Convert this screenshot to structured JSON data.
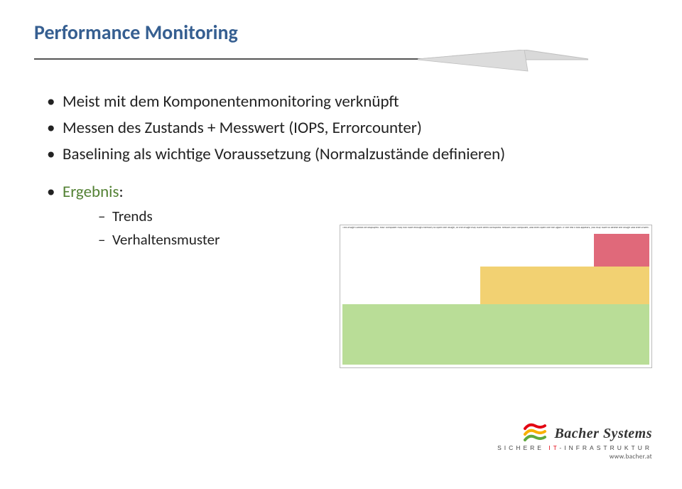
{
  "title": "Performance Monitoring",
  "bullets": [
    "Meist mit dem Komponentenmonitoring verknüpft",
    "Messen des Zustands + Messwert (IOPS, Errorcounter)",
    "Baselining als wichtige Voraussetzung (Normalzustände definieren)"
  ],
  "result": {
    "label": "Ergebnis",
    "colon": ":",
    "items": [
      "Trends",
      "Verhaltensmuster"
    ]
  },
  "chart_data": {
    "type": "bar",
    "caption": "This image cannot be displayed. Your computer may not have enough memory to open the image, or the image may have been corrupted. Restart your computer, and then open the file again. If the red x still appears, you may have to delete the image and then insert it again.",
    "bands": [
      {
        "name": "green",
        "color": "#b9dd97",
        "width_pct": 100,
        "height_pct": 46
      },
      {
        "name": "yellow",
        "color": "#f2d172",
        "width_pct": 55,
        "height_pct": 29
      },
      {
        "name": "red",
        "color": "#e0697a",
        "width_pct": 18,
        "height_pct": 25
      }
    ]
  },
  "footer": {
    "brand": "Bacher Systems",
    "tagline_prefix": "SICHERE ",
    "tagline_accent": "IT",
    "tagline_suffix": "-INFRASTRUKTUR",
    "url": "www.bacher.at"
  }
}
